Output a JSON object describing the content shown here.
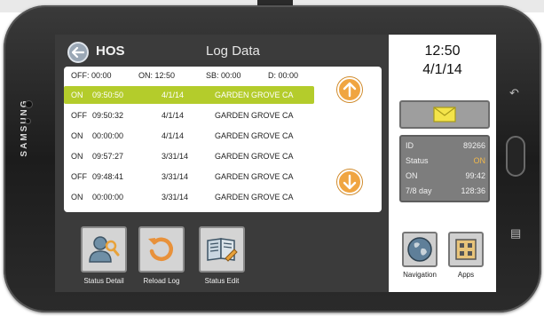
{
  "device": {
    "brand": "SAMSUNG"
  },
  "header": {
    "app_title": "HOS",
    "screen_title": "Log Data"
  },
  "summary": {
    "off": "OFF: 00:00",
    "on": "ON:  12:50",
    "sb": "SB:  00:00",
    "d": "D:  00:00"
  },
  "log": {
    "rows": [
      {
        "status": "ON",
        "time": "09:50:50",
        "date": "4/1/14",
        "location": "GARDEN GROVE CA"
      },
      {
        "status": "OFF",
        "time": "09:50:32",
        "date": "4/1/14",
        "location": "GARDEN GROVE CA"
      },
      {
        "status": "ON",
        "time": "00:00:00",
        "date": "4/1/14",
        "location": "GARDEN GROVE CA"
      },
      {
        "status": "ON",
        "time": "09:57:27",
        "date": "3/31/14",
        "location": "GARDEN GROVE CA"
      },
      {
        "status": "OFF",
        "time": "09:48:41",
        "date": "3/31/14",
        "location": "GARDEN GROVE CA"
      },
      {
        "status": "ON",
        "time": "00:00:00",
        "date": "3/31/14",
        "location": "GARDEN GROVE CA"
      }
    ],
    "selected_index": 0
  },
  "actions": {
    "status_detail": "Status Detail",
    "reload_log": "Reload Log",
    "status_edit": "Status Edit"
  },
  "right_panel": {
    "time": "12:50",
    "date": "4/1/14",
    "status": [
      {
        "key": "ID",
        "value": "89266"
      },
      {
        "key": "Status",
        "value": "ON"
      },
      {
        "key": "ON",
        "value": "99:42"
      },
      {
        "key": "7/8 day",
        "value": "128:36"
      }
    ],
    "navigation_label": "Navigation",
    "apps_label": "Apps"
  },
  "colors": {
    "selected_row": "#b4cc2b",
    "scroll_button": "#f0a541",
    "status_on": "#f1b84a",
    "screen_bg": "#3b3b3b"
  },
  "icons": {
    "back": "arrow-left-icon",
    "scroll_up": "arrow-up-icon",
    "scroll_down": "arrow-down-icon",
    "message": "envelope-icon",
    "status_detail": "user-search-icon",
    "reload": "reload-icon",
    "edit": "edit-document-icon",
    "navigation": "globe-icon",
    "apps": "apps-grid-icon"
  }
}
